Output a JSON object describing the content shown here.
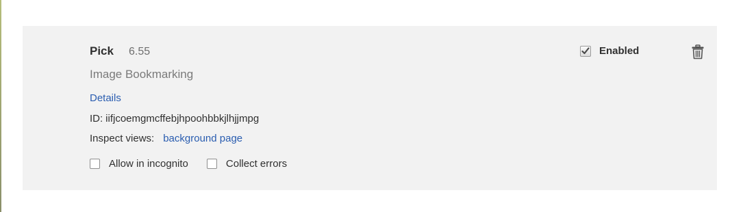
{
  "extension": {
    "name": "Pick",
    "version": "6.55",
    "description": "Image Bookmarking",
    "details_label": "Details",
    "id_label": "ID:",
    "id_value": "iifjcoemgmcffebjhpoohbbkjlhjjmpg",
    "inspect_label": "Inspect views:",
    "inspect_link": "background page",
    "enabled_label": "Enabled",
    "enabled": true,
    "options": [
      {
        "label": "Allow in incognito",
        "checked": false
      },
      {
        "label": "Collect errors",
        "checked": false
      }
    ]
  },
  "icons": {
    "remove": "trash-icon",
    "enabled_check": "checkmark-icon"
  },
  "colors": {
    "card_background": "#f2f2f2",
    "link": "#2a5db0",
    "text": "#303030",
    "muted_text": "#7a7a7a"
  }
}
